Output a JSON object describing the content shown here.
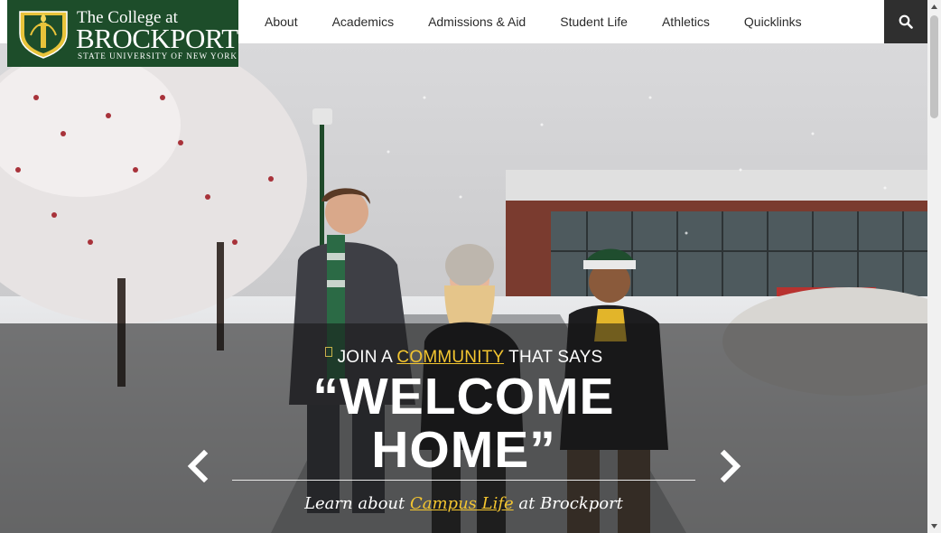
{
  "logo": {
    "line1": "The College at",
    "line2": "BROCKPORT",
    "line3": "State University of New York"
  },
  "nav": {
    "items": [
      "About",
      "Academics",
      "Admissions & Aid",
      "Student Life",
      "Athletics",
      "Quicklinks"
    ]
  },
  "icons": {
    "search": "search-icon",
    "prev": "chevron-left-icon",
    "next": "chevron-right-icon"
  },
  "hero": {
    "kicker_before": "JOIN A ",
    "kicker_link": "COMMUNITY",
    "kicker_after": " THAT SAYS",
    "headline_line1": "“WELCOME",
    "headline_line2": "HOME”",
    "sub_before": "Learn about ",
    "sub_link": "Campus Life",
    "sub_after": " at Brockport"
  },
  "colors": {
    "brand_green": "#1d4d2a",
    "accent_gold": "#f3c530",
    "search_bg": "#2f2f2f"
  }
}
